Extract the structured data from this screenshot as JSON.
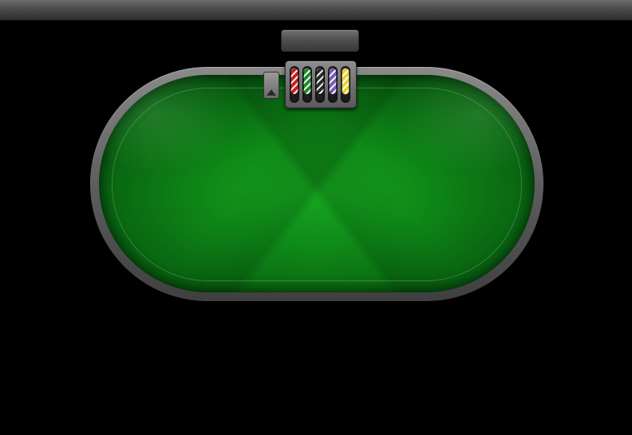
{
  "scene": {
    "background": "#000000",
    "top_bar_color": "#555555",
    "felt_color": "#16a420",
    "rail_color": "#6e6e6e"
  },
  "chip_tray": {
    "chips": [
      {
        "name": "red-chip",
        "color": "#c81e1e"
      },
      {
        "name": "green-chip",
        "color": "#1c8a2a"
      },
      {
        "name": "black-chip",
        "color": "#2b2b2b"
      },
      {
        "name": "purple-chip",
        "color": "#7a5ab5"
      },
      {
        "name": "yellow-chip",
        "color": "#e6d233"
      }
    ]
  }
}
